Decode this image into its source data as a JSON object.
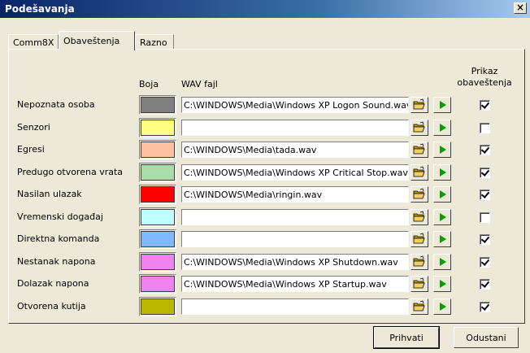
{
  "window": {
    "title": "Podešavanja",
    "close_glyph": "×"
  },
  "tabs": [
    {
      "label": "Comm8X",
      "active": false
    },
    {
      "label": "Obaveštenja",
      "active": true
    },
    {
      "label": "Razno",
      "active": false
    }
  ],
  "headers": {
    "color": "Boja",
    "file": "WAV fajl",
    "notify": "Prikaz obaveštenja"
  },
  "rows": [
    {
      "label": "Nepoznata osoba",
      "color": "#808080",
      "file": "C:\\WINDOWS\\Media\\Windows XP Logon Sound.wav",
      "checked": true
    },
    {
      "label": "Senzori",
      "color": "#ffff80",
      "file": "",
      "checked": false
    },
    {
      "label": "Egresi",
      "color": "#ffc0a0",
      "file": "C:\\WINDOWS\\Media\\tada.wav",
      "checked": true
    },
    {
      "label": "Predugo otvorena vrata",
      "color": "#a8dca8",
      "file": "C:\\WINDOWS\\Media\\Windows XP Critical Stop.wav",
      "checked": true
    },
    {
      "label": "Nasilan ulazak",
      "color": "#ff0000",
      "file": "C:\\WINDOWS\\Media\\ringin.wav",
      "checked": true
    },
    {
      "label": "Vremenski događaj",
      "color": "#c0ffff",
      "file": "",
      "checked": false
    },
    {
      "label": "Direktna komanda",
      "color": "#80b8ff",
      "file": "",
      "checked": true
    },
    {
      "label": "Nestanak napona",
      "color": "#ee82ee",
      "file": "C:\\WINDOWS\\Media\\Windows XP Shutdown.wav",
      "checked": true
    },
    {
      "label": "Dolazak napona",
      "color": "#ee82ee",
      "file": "C:\\WINDOWS\\Media\\Windows XP Startup.wav",
      "checked": true
    },
    {
      "label": "Otvorena kutija",
      "color": "#b8b800",
      "file": "",
      "checked": true
    }
  ],
  "icons": {
    "browse": "folder-open-icon",
    "play": "play-icon"
  },
  "buttons": {
    "ok": "Prihvati",
    "cancel": "Odustani"
  }
}
